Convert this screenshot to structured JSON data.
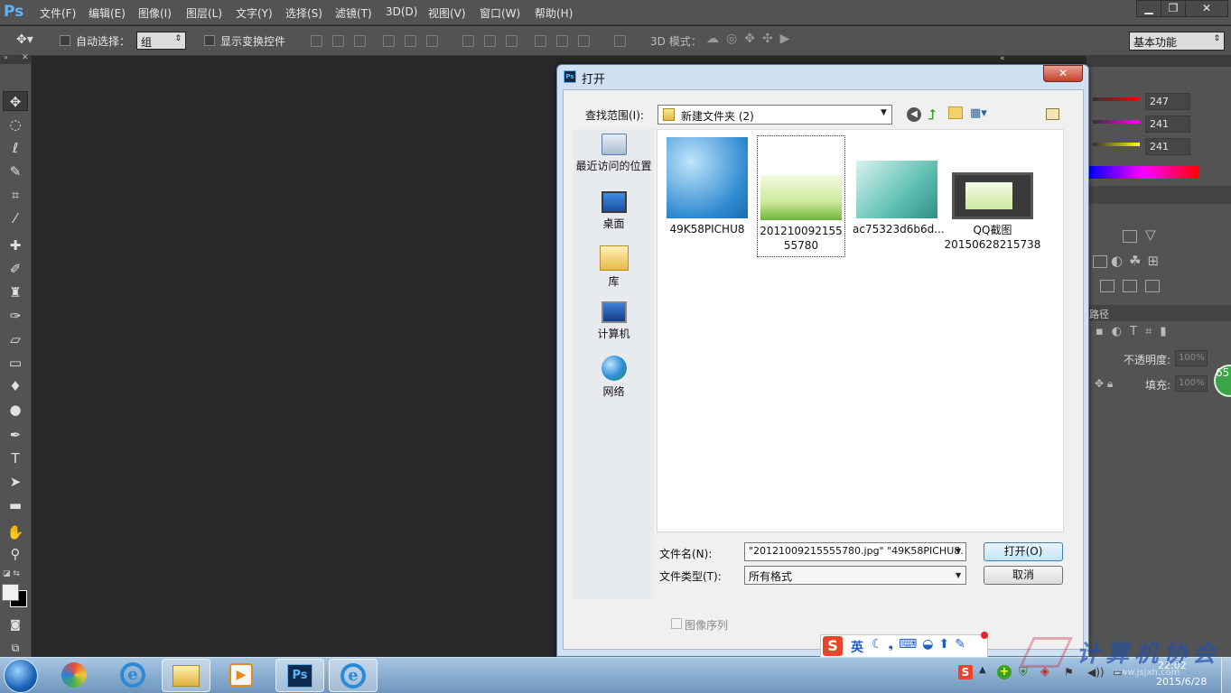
{
  "app": {
    "logo": "Ps"
  },
  "menubar": {
    "items": [
      "文件(F)",
      "编辑(E)",
      "图像(I)",
      "图层(L)",
      "文字(Y)",
      "选择(S)",
      "滤镜(T)",
      "3D(D)",
      "视图(V)",
      "窗口(W)",
      "帮助(H)"
    ],
    "window_buttons": {
      "minimize": "▁",
      "restore": "❐",
      "close": "✕"
    }
  },
  "options": {
    "auto_select_label": "自动选择：",
    "auto_select_value": "组",
    "show_transform_label": "显示变换控件",
    "mode3d_label": "3D 模式：",
    "workspace": "基本功能"
  },
  "panels": {
    "color_values": [
      "247",
      "241",
      "241"
    ],
    "paths_label": "路径",
    "opacity_label": "不透明度:",
    "opacity_value": "100%",
    "fill_label": "填充:",
    "fill_value": "100%",
    "badge": "65"
  },
  "dialog": {
    "title": "打开",
    "close": "✕",
    "look_in_label": "查找范围(I):",
    "look_in_value": "新建文件夹 (2)",
    "places": [
      {
        "label": "最近访问的位置",
        "icon": "recent-places-icon"
      },
      {
        "label": "桌面",
        "icon": "desktop-icon"
      },
      {
        "label": "库",
        "icon": "libraries-icon"
      },
      {
        "label": "计算机",
        "icon": "computer-icon"
      },
      {
        "label": "网络",
        "icon": "network-icon"
      }
    ],
    "files": [
      {
        "name": "49K58PICHU8"
      },
      {
        "name": "20121009215555780"
      },
      {
        "name": "ac75323d6b6d..."
      },
      {
        "name": "QQ截图 20150628215738"
      }
    ],
    "file_name_label": "文件名(N):",
    "file_name_value": "\"20121009215555780.jpg\" \"49K58PICHU8.",
    "file_type_label": "文件类型(T):",
    "file_type_value": "所有格式",
    "open_button": "打开(O)",
    "cancel_button": "取消",
    "image_sequence_label": "图像序列"
  },
  "ime": {
    "logo": "S",
    "mode": "英"
  },
  "watermark": "计算机协会",
  "watermark_url": "www.jsjxh.com",
  "clock": {
    "time": "22:02",
    "date": "2015/6/28"
  },
  "colors": {
    "ps_bg": "#282828",
    "chrome": "#535353",
    "dialog_frame": "#cfe0f1",
    "taskbar": "#8cb0d3"
  }
}
